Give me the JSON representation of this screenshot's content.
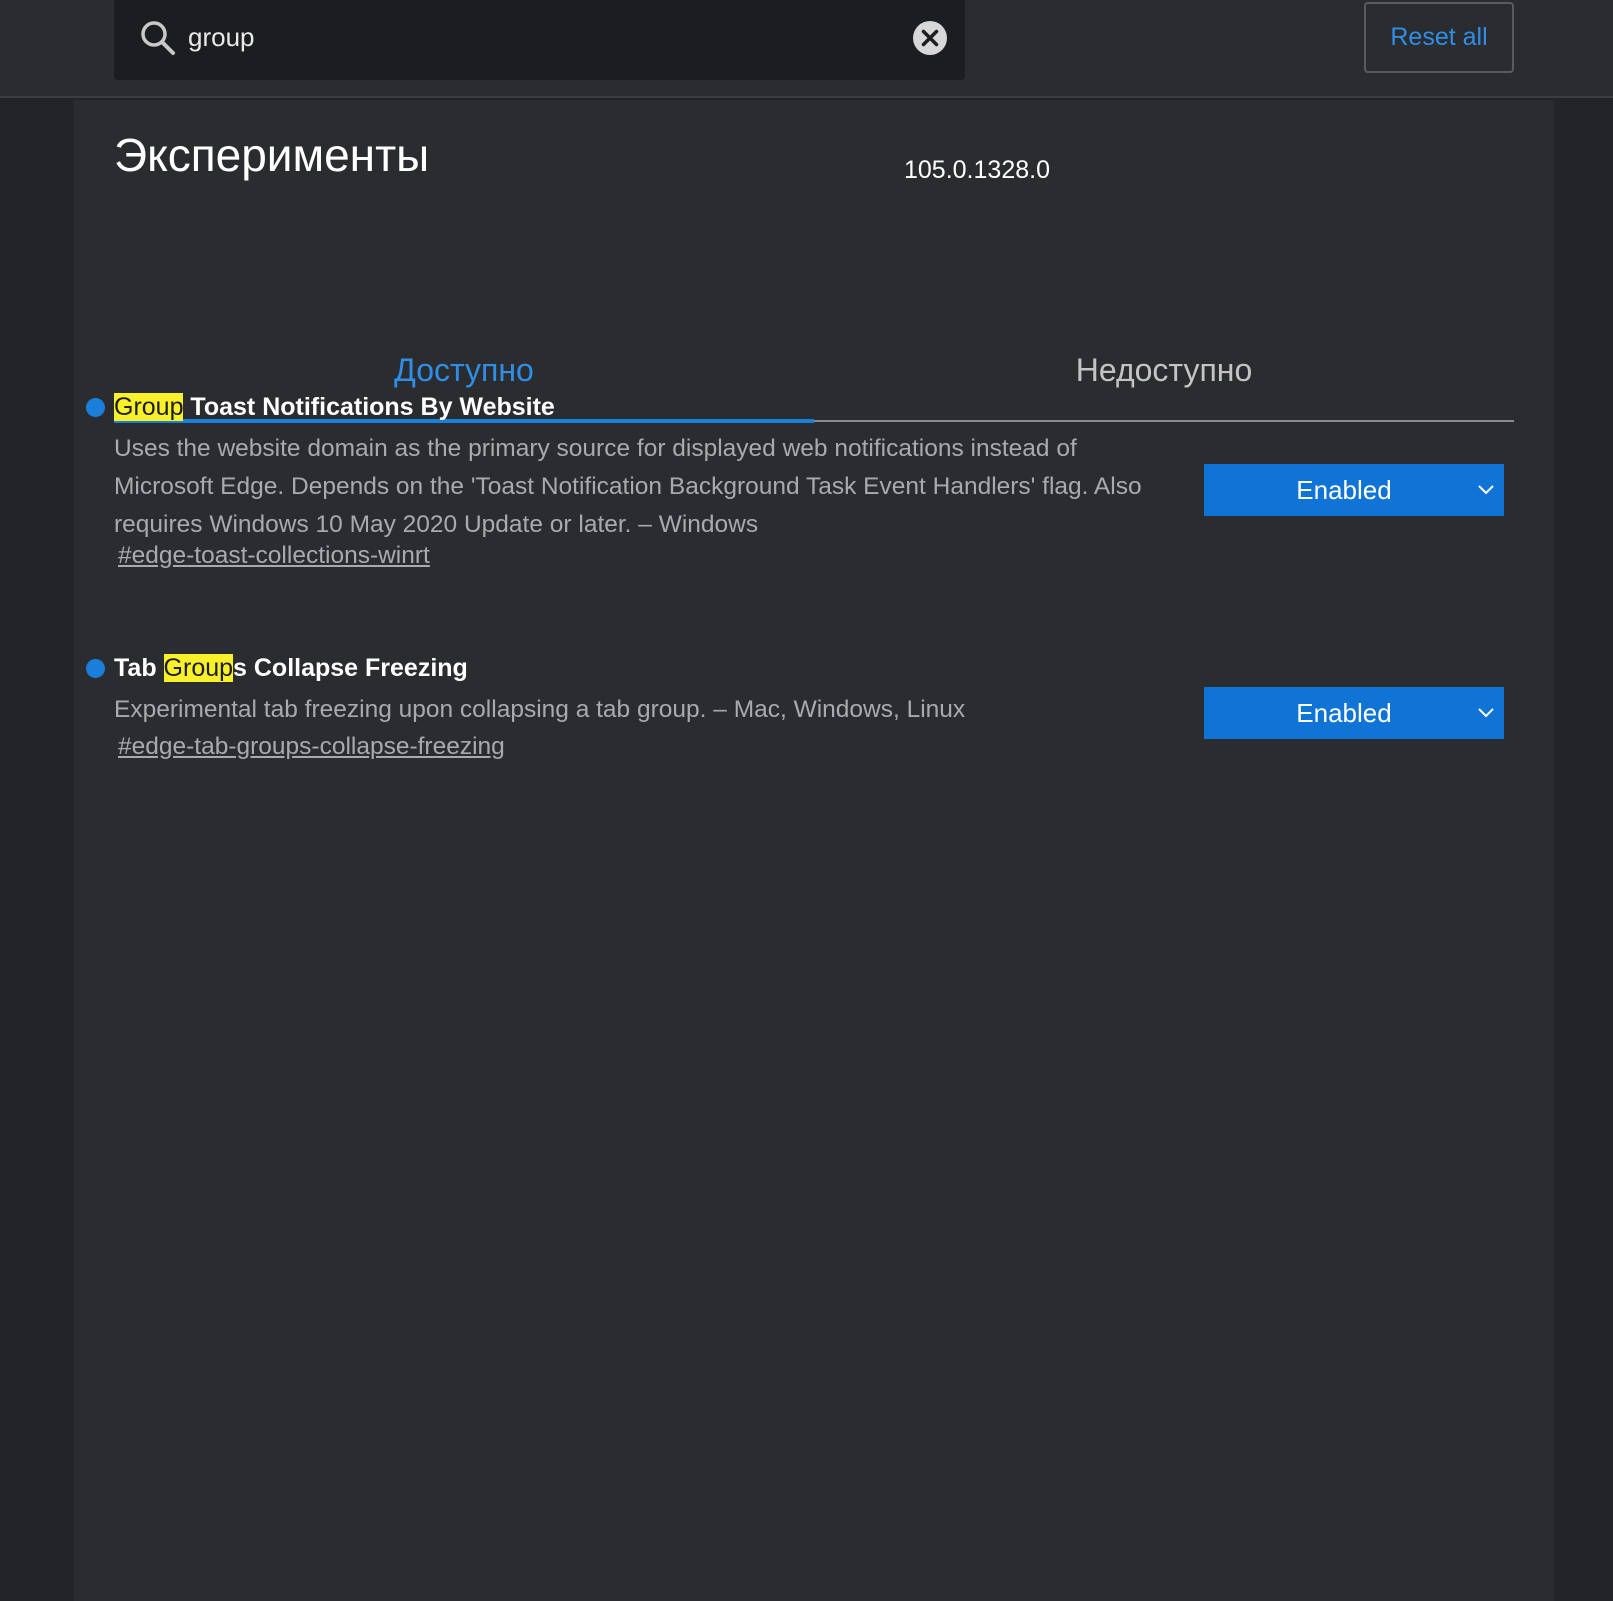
{
  "search": {
    "value": "group",
    "placeholder": ""
  },
  "header": {
    "reset_label": "Reset all"
  },
  "page": {
    "title": "Эксперименты",
    "version": "105.0.1328.0"
  },
  "tabs": [
    {
      "label": "Доступно",
      "active": true
    },
    {
      "label": "Недоступно",
      "active": false
    }
  ],
  "flags": [
    {
      "title_highlight": "Group",
      "title_rest": " Toast Notifications By Website",
      "description": "Uses the website domain as the primary source for displayed web notifications instead of Microsoft Edge. Depends on the 'Toast Notification Background Task Event Handlers' flag. Also requires Windows 10 May 2020 Update or later. – Windows",
      "link": "#edge-toast-collections-winrt",
      "state": "Enabled"
    },
    {
      "title_prefix": "Tab ",
      "title_highlight": "Group",
      "title_rest": "s Collapse Freezing",
      "description": "Experimental tab freezing upon collapsing a tab group. – Mac, Windows, Linux",
      "link": "#edge-tab-groups-collapse-freezing",
      "state": "Enabled"
    }
  ],
  "colors": {
    "accent": "#1a7fdb",
    "highlight": "#f7f02a",
    "background": "#2b2c30"
  }
}
